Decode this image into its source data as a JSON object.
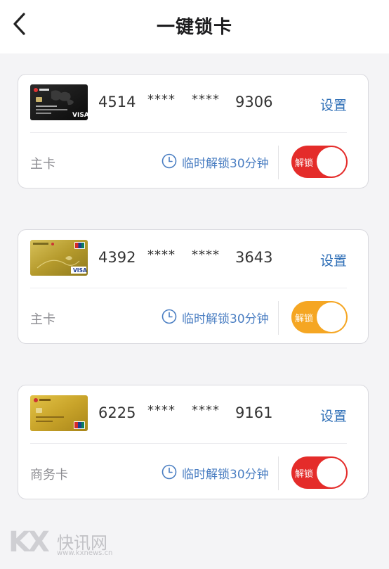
{
  "header": {
    "title": "一键锁卡"
  },
  "cards": [
    {
      "first4": "4514",
      "mask1": "****",
      "mask2": "****",
      "last4": "9306",
      "settings_label": "设置",
      "type_label": "主卡",
      "temp_unlock_label": "临时解锁30分钟",
      "toggle_label": "解锁",
      "toggle_color": "#e42c2a",
      "card_art": "black card with world map and VISA logo"
    },
    {
      "first4": "4392",
      "mask1": "****",
      "mask2": "****",
      "last4": "3643",
      "settings_label": "设置",
      "type_label": "主卡",
      "temp_unlock_label": "临时解锁30分钟",
      "toggle_label": "解锁",
      "toggle_color": "#f5a623",
      "card_art": "gold card with UnionPay and VISA logos"
    },
    {
      "first4": "6225",
      "mask1": "****",
      "mask2": "****",
      "last4": "9161",
      "settings_label": "设置",
      "type_label": "商务卡",
      "temp_unlock_label": "临时解锁30分钟",
      "toggle_label": "解锁",
      "toggle_color": "#e42c2a",
      "card_art": "gold card with UnionPay logo"
    }
  ],
  "watermark": {
    "logo": "KX",
    "title": "快讯网",
    "url": "www.kxnews.cn"
  },
  "colors": {
    "accent_blue": "#2f6fb7",
    "background": "#f4f4f6"
  }
}
